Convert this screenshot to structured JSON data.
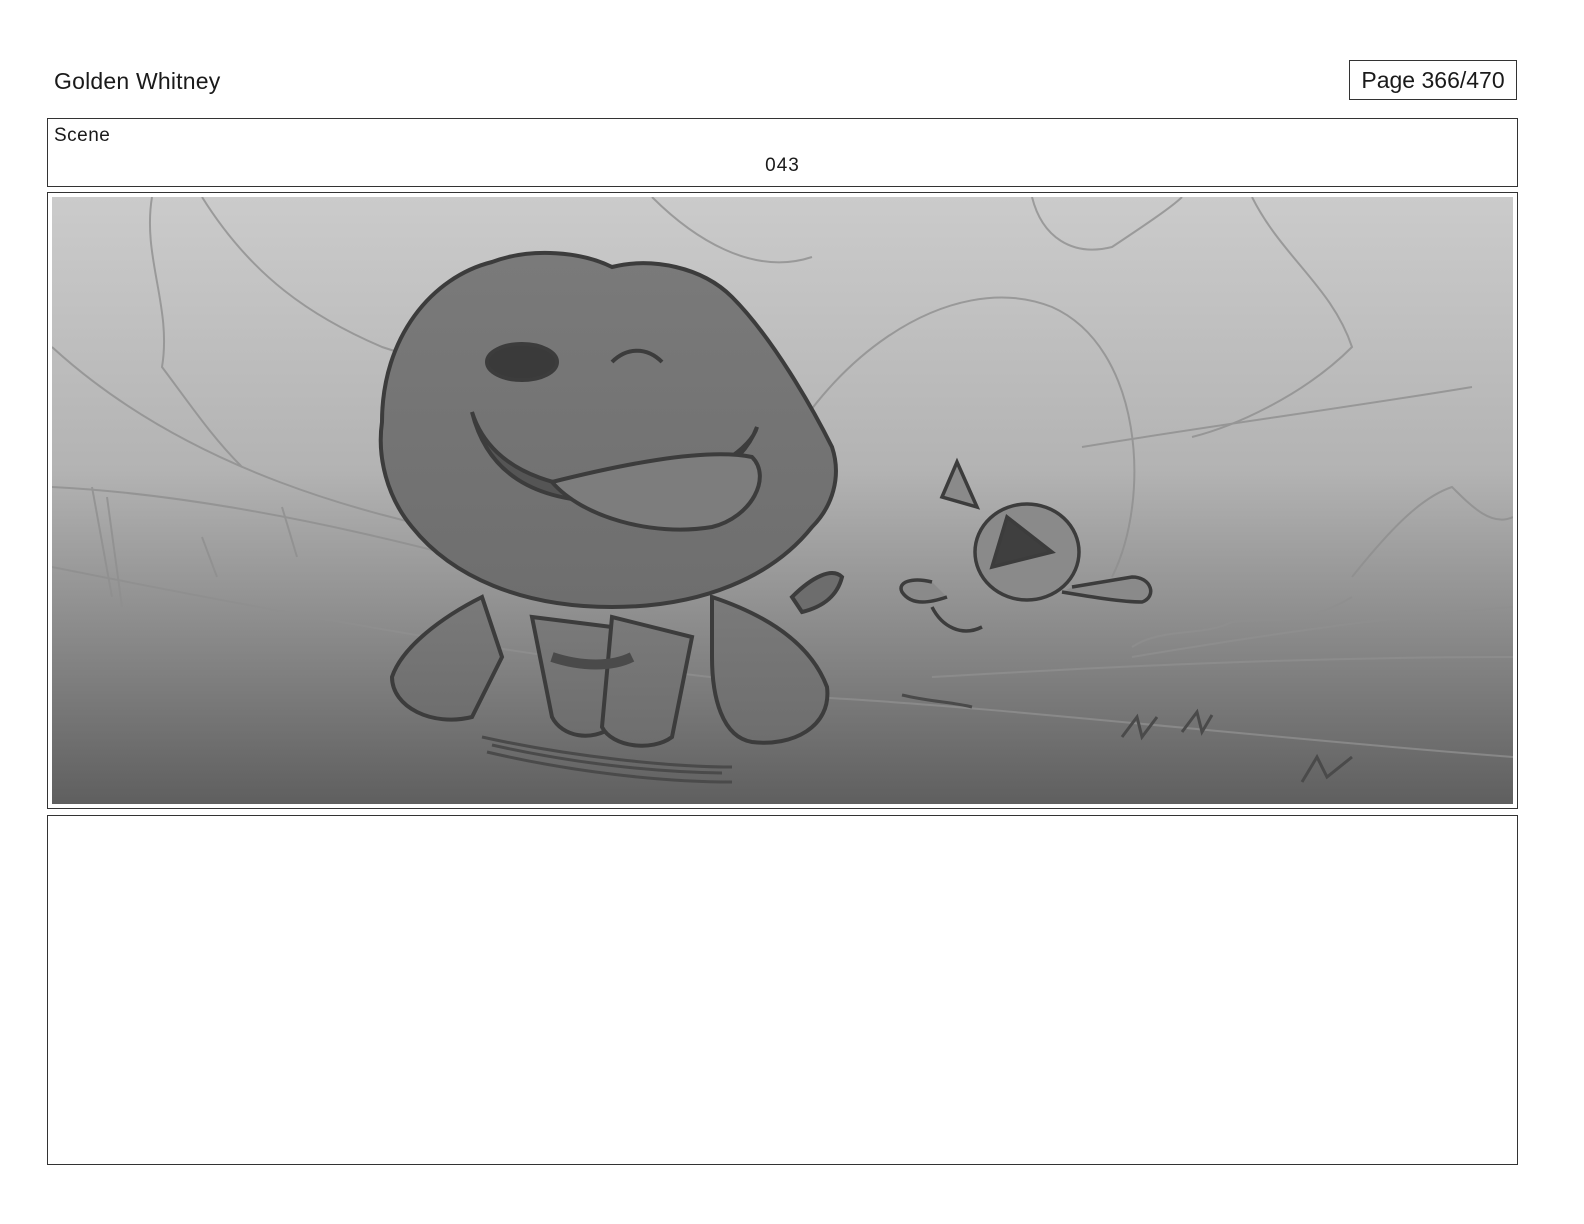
{
  "header": {
    "project_title": "Golden Whitney",
    "page_counter": "Page 366/470"
  },
  "scene": {
    "label": "Scene",
    "number": "043"
  },
  "panel": {
    "image_subject": "storyboard-sketch-dog-and-cat-running"
  },
  "notes": {
    "text": ""
  },
  "colors": {
    "border": "#333333",
    "sketch_sky_top": "#c9c9c9",
    "sketch_ground_bottom": "#5e5e5e",
    "sketch_ink": "#3f3f3f"
  }
}
